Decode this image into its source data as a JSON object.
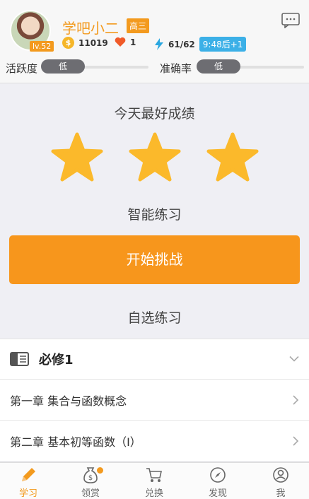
{
  "header": {
    "username": "学吧小二",
    "level": "lv.52",
    "grade": "高三",
    "coins": "11019",
    "hearts": "1",
    "energy": "61/62",
    "energy_timer": "9:48后+1",
    "activity_label": "活跃度",
    "activity_value": "低",
    "accuracy_label": "准确率",
    "accuracy_value": "低"
  },
  "main": {
    "best_today_title": "今天最好成绩",
    "star_count": 3,
    "star_color": "#fbb92b",
    "smart_practice_title": "智能练习",
    "start_button": "开始挑战",
    "custom_practice_title": "自选练习"
  },
  "course": {
    "title": "必修1",
    "chapters": [
      "第一章 集合与函数概念",
      "第二章 基本初等函数（Ⅰ）"
    ]
  },
  "tabs": [
    {
      "label": "学习",
      "icon": "pencil-icon",
      "active": true
    },
    {
      "label": "领赏",
      "icon": "money-bag-icon",
      "active": false
    },
    {
      "label": "兑换",
      "icon": "cart-icon",
      "active": false
    },
    {
      "label": "发现",
      "icon": "compass-icon",
      "active": false
    },
    {
      "label": "我",
      "icon": "person-icon",
      "active": false
    }
  ],
  "colors": {
    "accent": "#f39a1e",
    "timer_badge": "#3cb0e7",
    "pill": "#6d6d72"
  }
}
